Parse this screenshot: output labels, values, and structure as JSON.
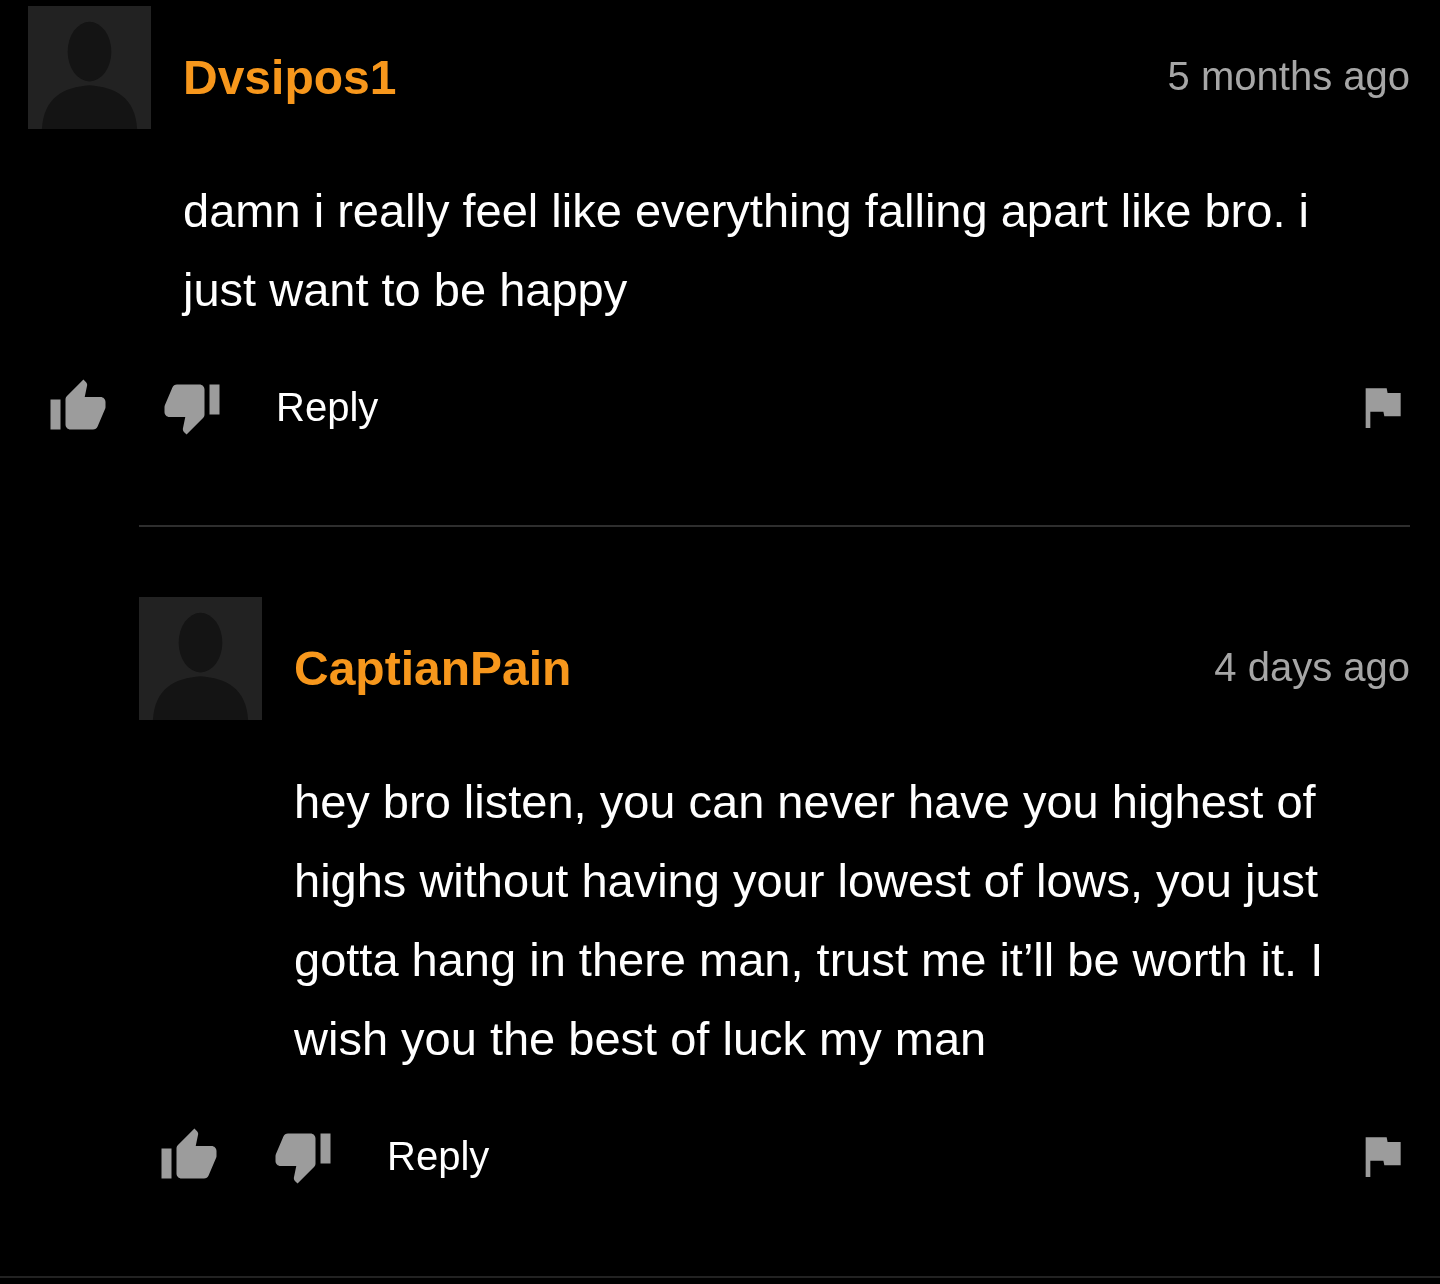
{
  "comments": [
    {
      "username": "Dvsipos1",
      "time": "5 months ago",
      "text": "damn i really feel like everything falling apart like bro. i just want to be happy",
      "reply_label": "Reply",
      "replies": [
        {
          "username": "CaptianPain",
          "time": "4 days ago",
          "text": "hey bro listen, you can never have you highest of highs without having your lowest of lows, you just gotta hang in there man, trust me it’ll be worth it. I wish you the best of luck my man",
          "reply_label": "Reply"
        }
      ]
    }
  ]
}
